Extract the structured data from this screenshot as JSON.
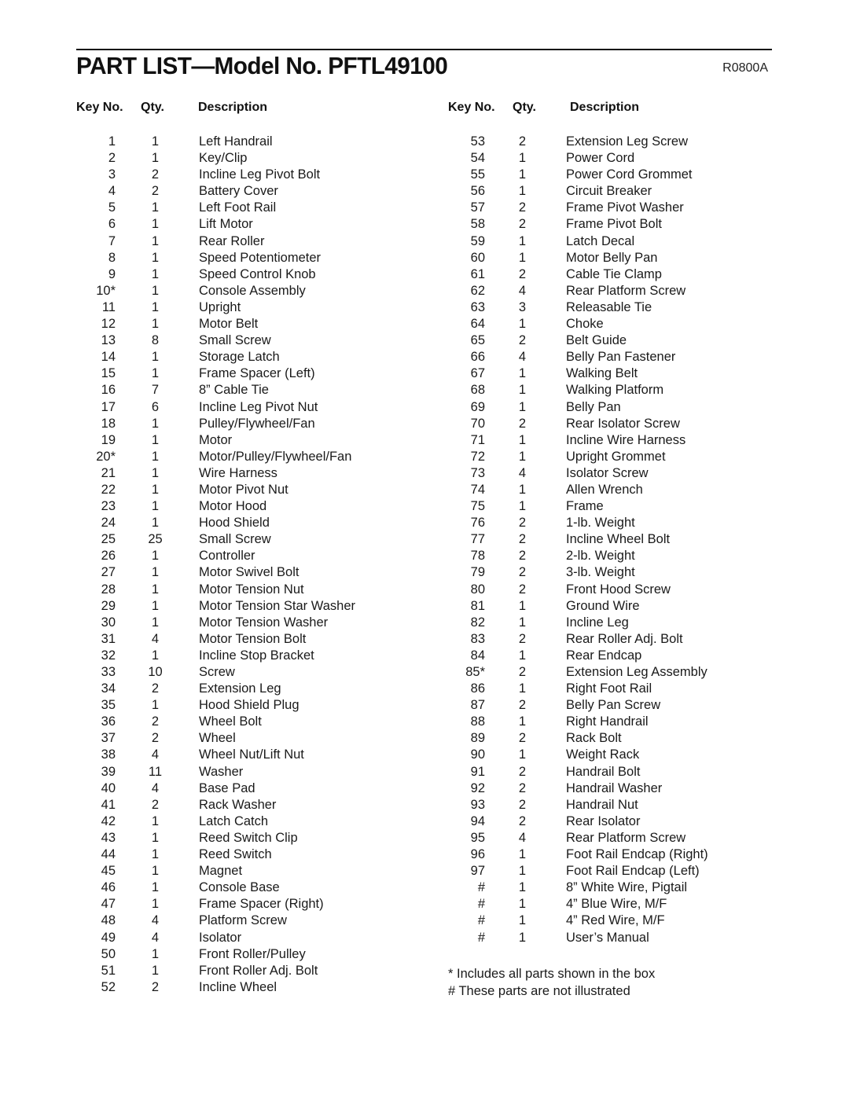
{
  "header": {
    "title": "PART LIST—Model No. PFTL49100",
    "doc_code": "R0800A"
  },
  "columns": {
    "key_label": "Key No.",
    "qty_label": "Qty.",
    "desc_label": "Description"
  },
  "left_parts": [
    {
      "key": "1",
      "qty": "1",
      "desc": "Left Handrail"
    },
    {
      "key": "2",
      "qty": "1",
      "desc": "Key/Clip"
    },
    {
      "key": "3",
      "qty": "2",
      "desc": "Incline Leg Pivot Bolt"
    },
    {
      "key": "4",
      "qty": "2",
      "desc": "Battery Cover"
    },
    {
      "key": "5",
      "qty": "1",
      "desc": "Left Foot Rail"
    },
    {
      "key": "6",
      "qty": "1",
      "desc": "Lift Motor"
    },
    {
      "key": "7",
      "qty": "1",
      "desc": "Rear Roller"
    },
    {
      "key": "8",
      "qty": "1",
      "desc": "Speed Potentiometer"
    },
    {
      "key": "9",
      "qty": "1",
      "desc": "Speed Control Knob"
    },
    {
      "key": "10*",
      "qty": "1",
      "desc": "Console Assembly"
    },
    {
      "key": "11",
      "qty": "1",
      "desc": "Upright"
    },
    {
      "key": "12",
      "qty": "1",
      "desc": "Motor Belt"
    },
    {
      "key": "13",
      "qty": "8",
      "desc": "Small Screw"
    },
    {
      "key": "14",
      "qty": "1",
      "desc": "Storage Latch"
    },
    {
      "key": "15",
      "qty": "1",
      "desc": "Frame Spacer (Left)"
    },
    {
      "key": "16",
      "qty": "7",
      "desc": "8” Cable Tie"
    },
    {
      "key": "17",
      "qty": "6",
      "desc": "Incline Leg Pivot Nut"
    },
    {
      "key": "18",
      "qty": "1",
      "desc": "Pulley/Flywheel/Fan"
    },
    {
      "key": "19",
      "qty": "1",
      "desc": "Motor"
    },
    {
      "key": "20*",
      "qty": "1",
      "desc": "Motor/Pulley/Flywheel/Fan"
    },
    {
      "key": "21",
      "qty": "1",
      "desc": "Wire Harness"
    },
    {
      "key": "22",
      "qty": "1",
      "desc": "Motor Pivot Nut"
    },
    {
      "key": "23",
      "qty": "1",
      "desc": "Motor Hood"
    },
    {
      "key": "24",
      "qty": "1",
      "desc": "Hood Shield"
    },
    {
      "key": "25",
      "qty": "25",
      "desc": "Small Screw"
    },
    {
      "key": "26",
      "qty": "1",
      "desc": "Controller"
    },
    {
      "key": "27",
      "qty": "1",
      "desc": "Motor Swivel Bolt"
    },
    {
      "key": "28",
      "qty": "1",
      "desc": "Motor Tension Nut"
    },
    {
      "key": "29",
      "qty": "1",
      "desc": "Motor Tension Star Washer"
    },
    {
      "key": "30",
      "qty": "1",
      "desc": "Motor Tension Washer"
    },
    {
      "key": "31",
      "qty": "4",
      "desc": "Motor Tension Bolt"
    },
    {
      "key": "32",
      "qty": "1",
      "desc": "Incline Stop Bracket"
    },
    {
      "key": "33",
      "qty": "10",
      "desc": "Screw"
    },
    {
      "key": "34",
      "qty": "2",
      "desc": "Extension Leg"
    },
    {
      "key": "35",
      "qty": "1",
      "desc": "Hood Shield Plug"
    },
    {
      "key": "36",
      "qty": "2",
      "desc": "Wheel Bolt"
    },
    {
      "key": "37",
      "qty": "2",
      "desc": "Wheel"
    },
    {
      "key": "38",
      "qty": "4",
      "desc": "Wheel Nut/Lift Nut"
    },
    {
      "key": "39",
      "qty": "11",
      "desc": "Washer"
    },
    {
      "key": "40",
      "qty": "4",
      "desc": "Base Pad"
    },
    {
      "key": "41",
      "qty": "2",
      "desc": "Rack Washer"
    },
    {
      "key": "42",
      "qty": "1",
      "desc": "Latch Catch"
    },
    {
      "key": "43",
      "qty": "1",
      "desc": "Reed Switch Clip"
    },
    {
      "key": "44",
      "qty": "1",
      "desc": "Reed Switch"
    },
    {
      "key": "45",
      "qty": "1",
      "desc": "Magnet"
    },
    {
      "key": "46",
      "qty": "1",
      "desc": "Console Base"
    },
    {
      "key": "47",
      "qty": "1",
      "desc": "Frame Spacer (Right)"
    },
    {
      "key": "48",
      "qty": "4",
      "desc": "Platform Screw"
    },
    {
      "key": "49",
      "qty": "4",
      "desc": "Isolator"
    },
    {
      "key": "50",
      "qty": "1",
      "desc": "Front Roller/Pulley"
    },
    {
      "key": "51",
      "qty": "1",
      "desc": "Front Roller Adj. Bolt"
    },
    {
      "key": "52",
      "qty": "2",
      "desc": "Incline Wheel"
    }
  ],
  "right_parts": [
    {
      "key": "53",
      "qty": "2",
      "desc": "Extension Leg Screw"
    },
    {
      "key": "54",
      "qty": "1",
      "desc": "Power Cord"
    },
    {
      "key": "55",
      "qty": "1",
      "desc": "Power Cord Grommet"
    },
    {
      "key": "56",
      "qty": "1",
      "desc": "Circuit Breaker"
    },
    {
      "key": "57",
      "qty": "2",
      "desc": "Frame Pivot Washer"
    },
    {
      "key": "58",
      "qty": "2",
      "desc": "Frame Pivot Bolt"
    },
    {
      "key": "59",
      "qty": "1",
      "desc": "Latch Decal"
    },
    {
      "key": "60",
      "qty": "1",
      "desc": "Motor Belly Pan"
    },
    {
      "key": "61",
      "qty": "2",
      "desc": "Cable Tie Clamp"
    },
    {
      "key": "62",
      "qty": "4",
      "desc": "Rear Platform Screw"
    },
    {
      "key": "63",
      "qty": "3",
      "desc": "Releasable Tie"
    },
    {
      "key": "64",
      "qty": "1",
      "desc": "Choke"
    },
    {
      "key": "65",
      "qty": "2",
      "desc": "Belt Guide"
    },
    {
      "key": "66",
      "qty": "4",
      "desc": "Belly Pan Fastener"
    },
    {
      "key": "67",
      "qty": "1",
      "desc": "Walking Belt"
    },
    {
      "key": "68",
      "qty": "1",
      "desc": "Walking Platform"
    },
    {
      "key": "69",
      "qty": "1",
      "desc": "Belly Pan"
    },
    {
      "key": "70",
      "qty": "2",
      "desc": "Rear Isolator Screw"
    },
    {
      "key": "71",
      "qty": "1",
      "desc": "Incline Wire Harness"
    },
    {
      "key": "72",
      "qty": "1",
      "desc": "Upright Grommet"
    },
    {
      "key": "73",
      "qty": "4",
      "desc": "Isolator Screw"
    },
    {
      "key": "74",
      "qty": "1",
      "desc": "Allen Wrench"
    },
    {
      "key": "75",
      "qty": "1",
      "desc": "Frame"
    },
    {
      "key": "76",
      "qty": "2",
      "desc": "1-lb. Weight"
    },
    {
      "key": "77",
      "qty": "2",
      "desc": "Incline Wheel Bolt"
    },
    {
      "key": "78",
      "qty": "2",
      "desc": "2-lb. Weight"
    },
    {
      "key": "79",
      "qty": "2",
      "desc": "3-lb. Weight"
    },
    {
      "key": "80",
      "qty": "2",
      "desc": "Front Hood Screw"
    },
    {
      "key": "81",
      "qty": "1",
      "desc": "Ground Wire"
    },
    {
      "key": "82",
      "qty": "1",
      "desc": "Incline Leg"
    },
    {
      "key": "83",
      "qty": "2",
      "desc": "Rear Roller Adj. Bolt"
    },
    {
      "key": "84",
      "qty": "1",
      "desc": "Rear Endcap"
    },
    {
      "key": "85*",
      "qty": "2",
      "desc": "Extension Leg Assembly"
    },
    {
      "key": "86",
      "qty": "1",
      "desc": "Right Foot Rail"
    },
    {
      "key": "87",
      "qty": "2",
      "desc": "Belly Pan Screw"
    },
    {
      "key": "88",
      "qty": "1",
      "desc": "Right Handrail"
    },
    {
      "key": "89",
      "qty": "2",
      "desc": "Rack Bolt"
    },
    {
      "key": "90",
      "qty": "1",
      "desc": "Weight Rack"
    },
    {
      "key": "91",
      "qty": "2",
      "desc": "Handrail Bolt"
    },
    {
      "key": "92",
      "qty": "2",
      "desc": "Handrail Washer"
    },
    {
      "key": "93",
      "qty": "2",
      "desc": "Handrail Nut"
    },
    {
      "key": "94",
      "qty": "2",
      "desc": "Rear Isolator"
    },
    {
      "key": "95",
      "qty": "4",
      "desc": "Rear Platform Screw"
    },
    {
      "key": "96",
      "qty": "1",
      "desc": "Foot Rail Endcap (Right)"
    },
    {
      "key": "97",
      "qty": "1",
      "desc": "Foot Rail Endcap (Left)"
    },
    {
      "key": "#",
      "qty": "1",
      "desc": "8” White Wire, Pigtail"
    },
    {
      "key": "#",
      "qty": "1",
      "desc": "4” Blue Wire, M/F"
    },
    {
      "key": "#",
      "qty": "1",
      "desc": "4” Red Wire, M/F"
    },
    {
      "key": "#",
      "qty": "1",
      "desc": "User’s Manual"
    }
  ],
  "notes": [
    "* Includes all parts shown in the box",
    "# These parts are not illustrated"
  ]
}
